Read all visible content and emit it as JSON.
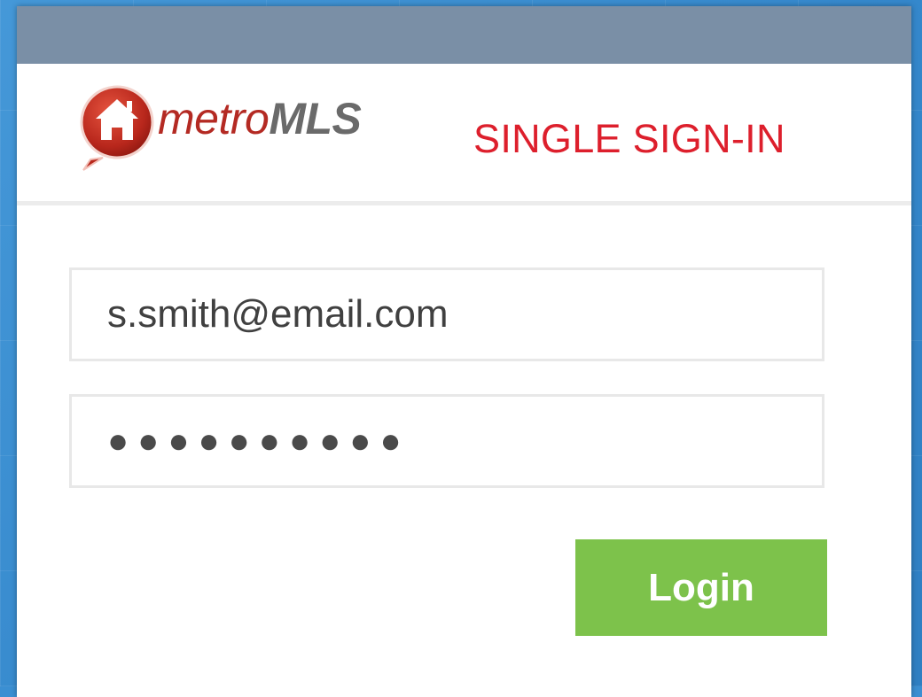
{
  "brand": {
    "name_part1": "metro",
    "name_part2": "MLS",
    "logo_icon": "house-speech-bubble-icon",
    "colors": {
      "logo_red": "#b42a23",
      "logo_gray": "#6a6a6a"
    }
  },
  "header": {
    "title": "SINGLE SIGN-IN",
    "title_color": "#dd1f2c",
    "bar_color": "#7a8fa6"
  },
  "form": {
    "email": {
      "value": "s.smith@email.com"
    },
    "password": {
      "value": "●●●●●●●●●●"
    },
    "login_label": "Login",
    "login_color": "#7dc24b"
  },
  "background_color": "#3b8fd2"
}
